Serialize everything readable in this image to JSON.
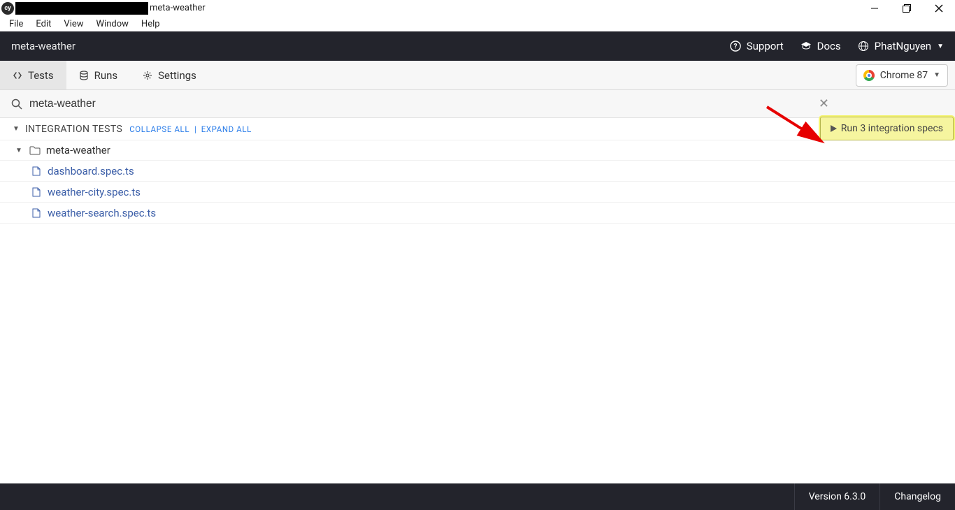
{
  "window": {
    "title_after_blackbox": "meta-weather"
  },
  "menu": {
    "items": [
      "File",
      "Edit",
      "View",
      "Window",
      "Help"
    ]
  },
  "topbar": {
    "project": "meta-weather",
    "support": "Support",
    "docs": "Docs",
    "user": "PhatNguyen"
  },
  "tabs": {
    "tests": "Tests",
    "runs": "Runs",
    "settings": "Settings"
  },
  "browser": {
    "label": "Chrome 87"
  },
  "search": {
    "value": "meta-weather"
  },
  "section": {
    "title": "INTEGRATION TESTS",
    "collapse": "COLLAPSE ALL",
    "expand": "EXPAND ALL",
    "separator": "|"
  },
  "run_button": "Run 3 integration specs",
  "folder": {
    "name": "meta-weather"
  },
  "files": [
    "dashboard.spec.ts",
    "weather-city.spec.ts",
    "weather-search.spec.ts"
  ],
  "footer": {
    "version": "Version 6.3.0",
    "changelog": "Changelog"
  }
}
